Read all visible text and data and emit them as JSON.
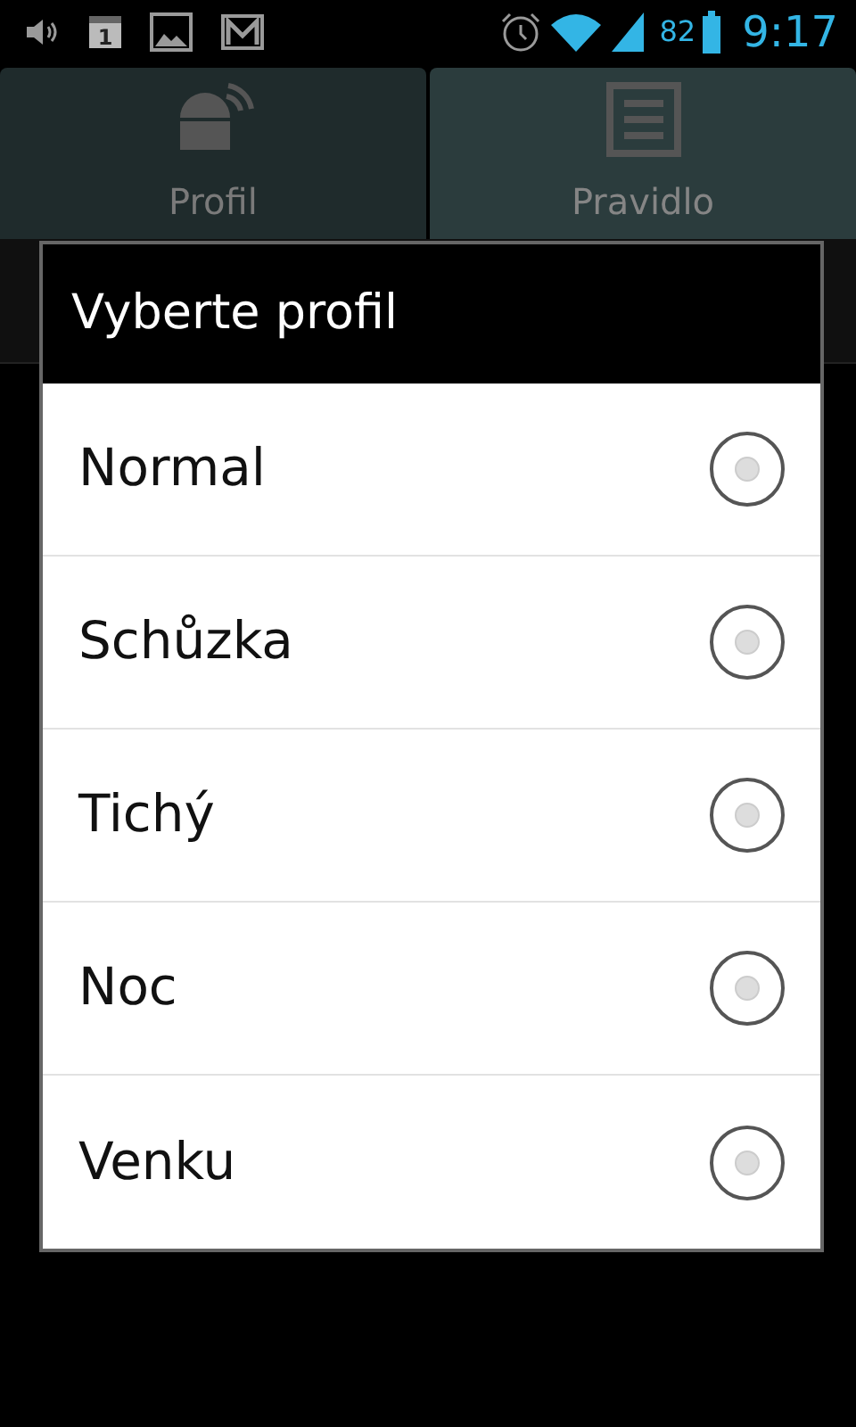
{
  "status_bar": {
    "calendar_day": "1",
    "battery": "82",
    "time": "9:17"
  },
  "tabs": [
    {
      "label": "Profil",
      "selected": false,
      "kind": "robot"
    },
    {
      "label": "Pravidlo",
      "selected": true,
      "kind": "list"
    }
  ],
  "dialog": {
    "title": "Vyberte profil",
    "options": [
      {
        "label": "Normal",
        "selected": false
      },
      {
        "label": "Schůzka",
        "selected": false
      },
      {
        "label": "Tichý",
        "selected": false
      },
      {
        "label": "Noc",
        "selected": false
      },
      {
        "label": "Venku",
        "selected": false
      }
    ]
  }
}
